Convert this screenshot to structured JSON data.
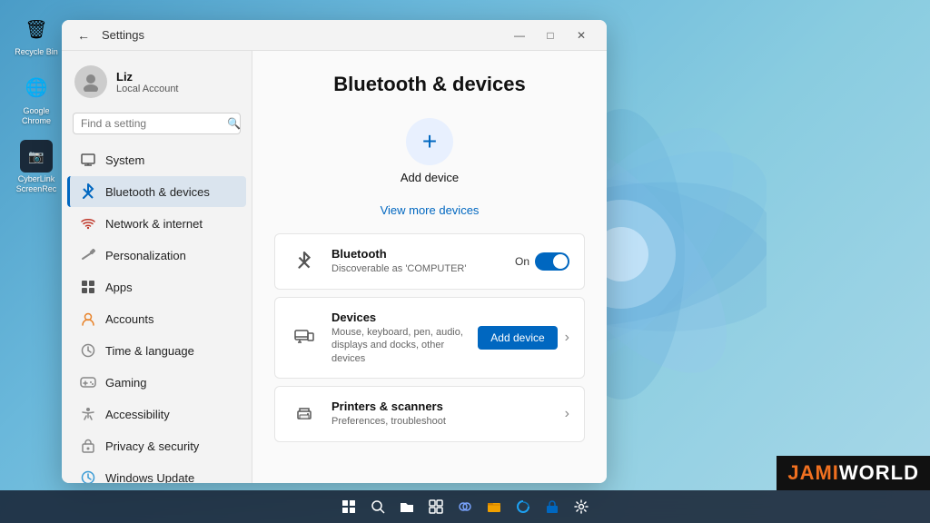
{
  "window": {
    "title": "Settings",
    "minimize": "—",
    "maximize": "□",
    "close": "✕"
  },
  "user": {
    "name": "Liz",
    "account_type": "Local Account"
  },
  "search": {
    "placeholder": "Find a setting"
  },
  "nav": {
    "items": [
      {
        "id": "system",
        "label": "System",
        "icon": "🖥",
        "active": false
      },
      {
        "id": "bluetooth",
        "label": "Bluetooth & devices",
        "icon": "🔷",
        "active": true
      },
      {
        "id": "network",
        "label": "Network & internet",
        "icon": "🌐",
        "active": false
      },
      {
        "id": "personalization",
        "label": "Personalization",
        "icon": "✏",
        "active": false
      },
      {
        "id": "apps",
        "label": "Apps",
        "icon": "📱",
        "active": false
      },
      {
        "id": "accounts",
        "label": "Accounts",
        "icon": "👤",
        "active": false
      },
      {
        "id": "time",
        "label": "Time & language",
        "icon": "🕐",
        "active": false
      },
      {
        "id": "gaming",
        "label": "Gaming",
        "icon": "🎮",
        "active": false
      },
      {
        "id": "accessibility",
        "label": "Accessibility",
        "icon": "♿",
        "active": false
      },
      {
        "id": "privacy",
        "label": "Privacy & security",
        "icon": "🔒",
        "active": false
      },
      {
        "id": "update",
        "label": "Windows Update",
        "icon": "🔄",
        "active": false
      }
    ]
  },
  "page": {
    "title": "Bluetooth & devices",
    "add_device_label": "Add device",
    "view_more_label": "View more devices"
  },
  "devices": [
    {
      "id": "bluetooth",
      "name": "Bluetooth",
      "description": "Discoverable as 'COMPUTER'",
      "status_label": "On",
      "toggle_on": true,
      "icon": "bluetooth"
    },
    {
      "id": "devices",
      "name": "Devices",
      "description": "Mouse, keyboard, pen, audio, displays and docks, other devices",
      "button_label": "Add device",
      "icon": "devices"
    },
    {
      "id": "printers",
      "name": "Printers & scanners",
      "description": "Preferences, troubleshoot",
      "icon": "printer"
    }
  ],
  "taskbar": {
    "icons": [
      "⊞",
      "🔍",
      "📁",
      "⊞",
      "📹",
      "📁",
      "🌐",
      "🔵",
      "⚙"
    ]
  },
  "desktop_icons": [
    {
      "label": "Recycle Bin",
      "icon": "🗑"
    },
    {
      "label": "Google Chrome",
      "icon": "🌐"
    },
    {
      "label": "CyberLink ScreenRec",
      "icon": "📷"
    }
  ],
  "watermark": {
    "jami": "JAMI",
    "world": "WORLD"
  }
}
